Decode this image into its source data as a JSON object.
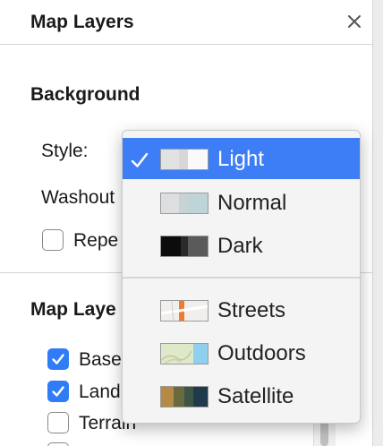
{
  "panel": {
    "title": "Map Layers",
    "close_icon": "close-icon",
    "background_section": {
      "title": "Background",
      "style_label": "Style:",
      "washout_label": "Washout",
      "repeat_label": "Repe",
      "repeat_checked": false
    },
    "layers_section": {
      "title": "Map Laye",
      "items": [
        {
          "label": "Base",
          "checked": true
        },
        {
          "label": "Land",
          "checked": true
        },
        {
          "label": "Terrain",
          "checked": false
        }
      ]
    }
  },
  "style_dropdown": {
    "selected": "Light",
    "options": [
      {
        "label": "Light",
        "icon": "light-map-swatch",
        "selected": true
      },
      {
        "label": "Normal",
        "icon": "normal-map-swatch",
        "selected": false
      },
      {
        "label": "Dark",
        "icon": "dark-map-swatch",
        "selected": false
      },
      {
        "label": "Streets",
        "icon": "streets-map-swatch",
        "selected": false
      },
      {
        "label": "Outdoors",
        "icon": "outdoors-map-swatch",
        "selected": false
      },
      {
        "label": "Satellite",
        "icon": "satellite-map-swatch",
        "selected": false
      }
    ]
  },
  "colors": {
    "accent": "#3d7ef6",
    "checkbox": "#2f7cf6"
  }
}
